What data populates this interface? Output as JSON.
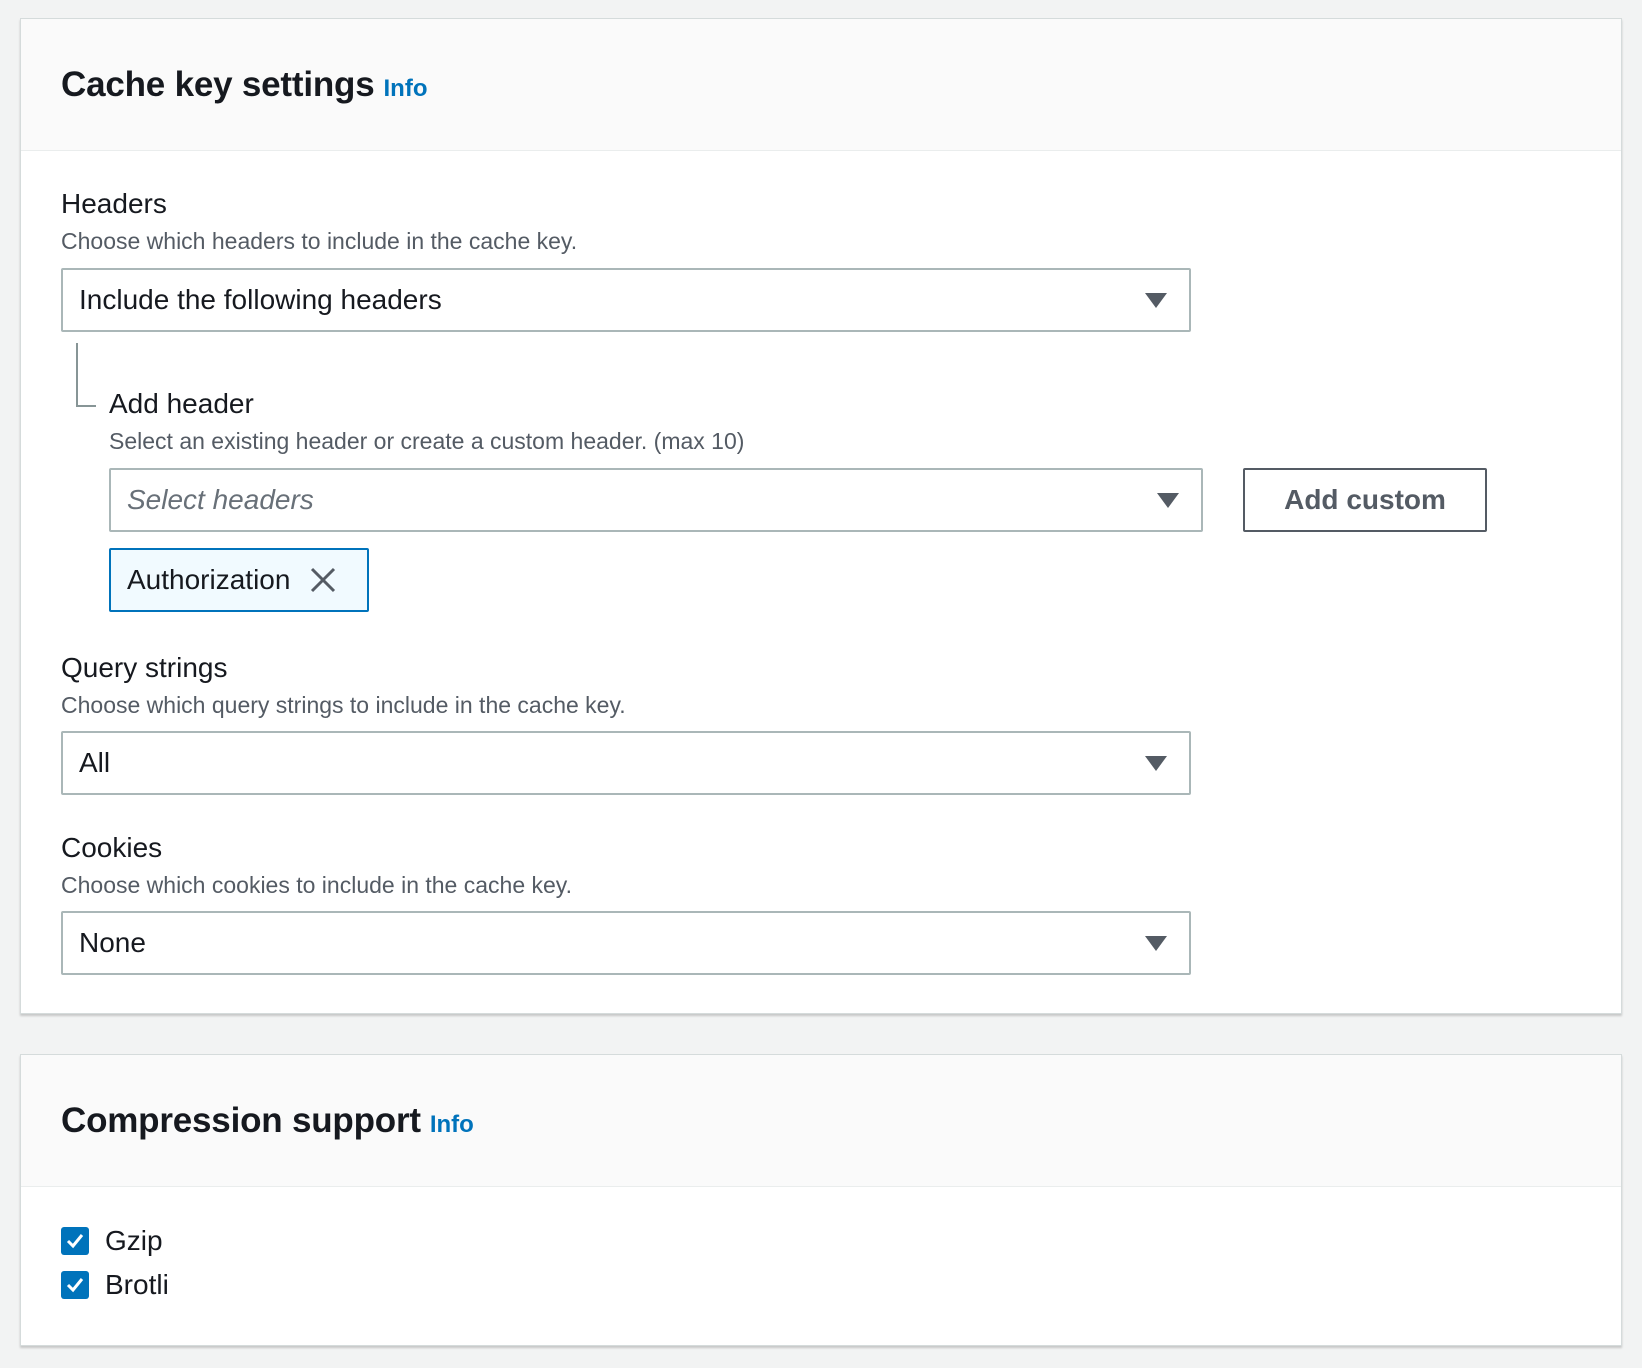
{
  "cache_key_settings": {
    "title": "Cache key settings",
    "info": "Info",
    "headers": {
      "label": "Headers",
      "description": "Choose which headers to include in the cache key.",
      "selected": "Include the following headers"
    },
    "add_header": {
      "label": "Add header",
      "description": "Select an existing header or create a custom header. (max 10)",
      "placeholder": "Select headers",
      "add_custom_label": "Add custom",
      "tokens": [
        "Authorization"
      ]
    },
    "query_strings": {
      "label": "Query strings",
      "description": "Choose which query strings to include in the cache key.",
      "selected": "All"
    },
    "cookies": {
      "label": "Cookies",
      "description": "Choose which cookies to include in the cache key.",
      "selected": "None"
    }
  },
  "compression_support": {
    "title": "Compression support",
    "info": "Info",
    "options": [
      {
        "label": "Gzip",
        "checked": true
      },
      {
        "label": "Brotli",
        "checked": true
      }
    ]
  },
  "colors": {
    "link": "#0073bb",
    "checkbox": "#0073bb",
    "token_bg": "#f1faff",
    "page_bg": "#f2f3f3"
  }
}
